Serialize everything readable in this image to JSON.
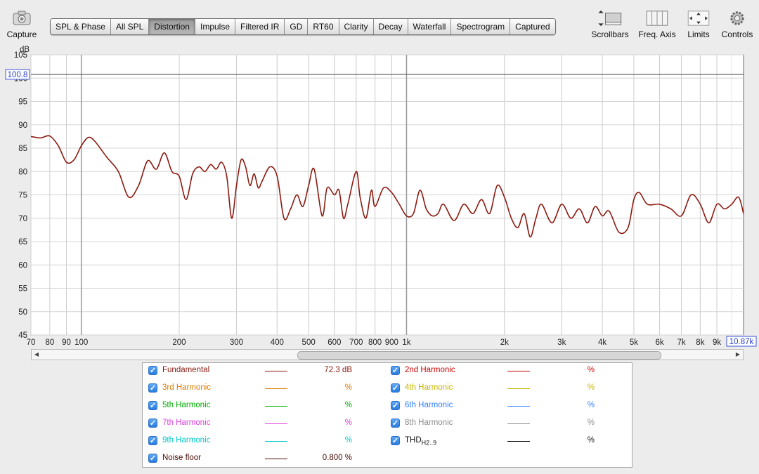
{
  "toolbar": {
    "capture_label": "Capture",
    "tabs": [
      "SPL & Phase",
      "All SPL",
      "Distortion",
      "Impulse",
      "Filtered IR",
      "GD",
      "RT60",
      "Clarity",
      "Decay",
      "Waterfall",
      "Spectrogram",
      "Captured"
    ],
    "active_tab": "Distortion",
    "right_tools": [
      "Scrollbars",
      "Freq. Axis",
      "Limits",
      "Controls"
    ]
  },
  "chart": {
    "y_unit": "dB",
    "y_ticks": [
      "105",
      "100",
      "95",
      "90",
      "85",
      "80",
      "75",
      "70",
      "65",
      "60",
      "55",
      "50",
      "45"
    ],
    "x_ticks": [
      "70",
      "80",
      "90",
      "100",
      "200",
      "300",
      "400",
      "500",
      "600",
      "700",
      "800",
      "900",
      "1k",
      "2k",
      "3k",
      "4k",
      "5k",
      "6k",
      "7k",
      "8k",
      "9k"
    ],
    "cursor_y_label": "100.8",
    "cursor_x_label": "10.87k"
  },
  "chart_data": {
    "type": "line",
    "xlabel": "",
    "ylabel": "dB",
    "xscale": "log",
    "xlim": [
      70,
      10870
    ],
    "ylim": [
      45,
      105
    ],
    "grid": true,
    "series": [
      {
        "name": "Fundamental",
        "color": "#8b1a10",
        "x": [
          70,
          75,
          80,
          85,
          90,
          95,
          100,
          105,
          110,
          120,
          130,
          140,
          150,
          160,
          170,
          180,
          190,
          200,
          210,
          220,
          230,
          240,
          250,
          260,
          270,
          280,
          290,
          300,
          310,
          320,
          330,
          340,
          350,
          360,
          380,
          400,
          420,
          440,
          460,
          480,
          500,
          520,
          550,
          570,
          600,
          620,
          640,
          660,
          700,
          720,
          750,
          780,
          800,
          850,
          900,
          950,
          1000,
          1050,
          1100,
          1150,
          1200,
          1250,
          1300,
          1400,
          1500,
          1600,
          1700,
          1800,
          1900,
          2000,
          2100,
          2200,
          2300,
          2400,
          2500,
          2600,
          2800,
          3000,
          3200,
          3400,
          3600,
          3800,
          4000,
          4200,
          4500,
          4800,
          5000,
          5200,
          5500,
          6000,
          6500,
          7000,
          7500,
          8000,
          8500,
          9000,
          9500,
          10000,
          10500,
          10870
        ],
        "y": [
          87.5,
          87.2,
          87.6,
          85.5,
          82.0,
          82.5,
          85.5,
          87.3,
          86.5,
          83.0,
          80.0,
          74.5,
          77.0,
          82.3,
          80.5,
          84.0,
          80.0,
          79.0,
          74.0,
          79.5,
          81.0,
          80.0,
          81.5,
          80.5,
          82.0,
          79.0,
          70.0,
          77.0,
          82.5,
          81.0,
          77.0,
          79.5,
          76.5,
          78.0,
          81.0,
          79.0,
          70.0,
          72.0,
          75.0,
          72.5,
          77.0,
          80.5,
          70.5,
          76.5,
          75.0,
          76.0,
          70.0,
          73.0,
          80.0,
          74.5,
          70.0,
          76.0,
          72.5,
          76.5,
          75.5,
          73.0,
          70.5,
          71.0,
          76.0,
          72.0,
          70.5,
          71.0,
          73.0,
          69.5,
          73.0,
          71.0,
          74.0,
          71.0,
          77.0,
          74.5,
          70.0,
          68.0,
          71.0,
          66.0,
          70.0,
          73.0,
          69.0,
          73.0,
          70.0,
          72.0,
          69.0,
          72.5,
          70.5,
          71.5,
          67.0,
          68.0,
          74.0,
          75.5,
          73.0,
          73.0,
          72.0,
          70.5,
          75.0,
          73.0,
          69.0,
          73.0,
          72.0,
          73.0,
          74.5,
          71.0
        ]
      }
    ]
  },
  "scrollbar": {
    "left_arrow": "◀",
    "right_arrow": "▶"
  },
  "legend": {
    "items": [
      {
        "label": "Fundamental",
        "value": "72.3 dB",
        "color": "#8b1a10",
        "checked": "✓"
      },
      {
        "label": "2nd Harmonic",
        "value": "%",
        "color": "#cc0000",
        "checked": "✓"
      },
      {
        "label": "3rd Harmonic",
        "value": "%",
        "color": "#e07b00",
        "checked": "✓"
      },
      {
        "label": "4th Harmonic",
        "value": "%",
        "color": "#c8b400",
        "checked": "✓"
      },
      {
        "label": "5th Harmonic",
        "value": "%",
        "color": "#00b000",
        "checked": "✓"
      },
      {
        "label": "6th Harmonic",
        "value": "%",
        "color": "#2f80ff",
        "checked": "✓"
      },
      {
        "label": "7th Harmonic",
        "value": "%",
        "color": "#e040e0",
        "checked": "✓"
      },
      {
        "label": "8th Harmonic",
        "value": "%",
        "color": "#8a8a8a",
        "checked": "✓"
      },
      {
        "label": "9th Harmonic",
        "value": "%",
        "color": "#00c8c8",
        "checked": "✓"
      },
      {
        "label": "THD",
        "sub": "H2..9",
        "value": "%",
        "color": "#000000",
        "checked": "✓"
      },
      {
        "label": "Noise floor",
        "value": "0.800 %",
        "color": "#4a0c06",
        "checked": "✓"
      }
    ]
  }
}
